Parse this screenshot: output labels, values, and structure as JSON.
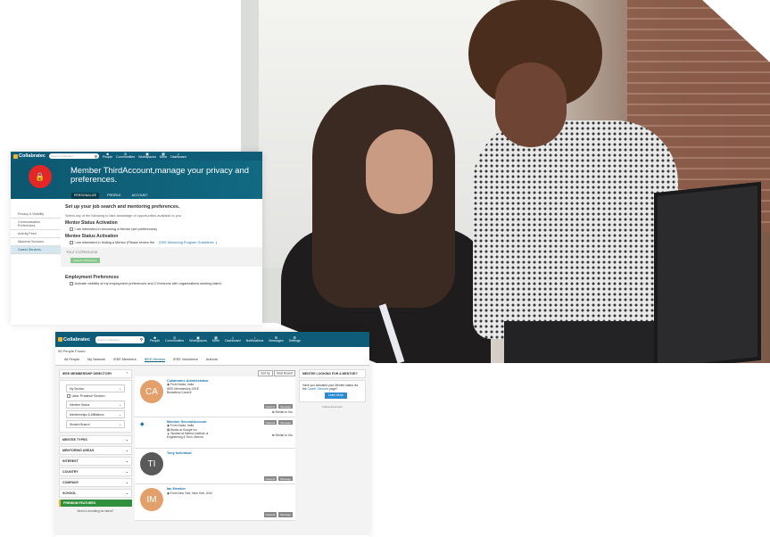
{
  "brand": {
    "name": "Collabratec",
    "mark": "IEEE"
  },
  "colors": {
    "nav": "#0f5c79",
    "accent": "#f2b334",
    "premium": "#2f8f3c",
    "button": "#2d8bd0"
  },
  "nav": {
    "search_placeholder": "Search Collabratec",
    "items": [
      "People",
      "Communities",
      "Workspaces",
      "More",
      "Dashboard",
      "Notifications",
      "Messages",
      "Settings"
    ]
  },
  "privacy": {
    "title": "Member ThirdAccount,manage your privacy and preferences.",
    "tabs": [
      "PERSONALIZE",
      "PROFILE",
      "ACCOUNT"
    ],
    "sidebar": [
      "Privacy & Visibility",
      "Communication Preferences",
      "Activity Feed",
      "Attached Services",
      "Career Services"
    ],
    "heading": "Set up your job search and mentoring preferences.",
    "intro": "Select any of the following to take advantage of opportunities available to you.",
    "mentor_status_title": "Mentor Status Activation",
    "mentor_status_option": "I am interested in becoming a Mentor (set preferences)",
    "mentee_status_title": "Mentee Status Activation",
    "mentee_status_option": "I am interested in finding a Mentor (Please review the",
    "mentee_link": "IEEE Mentoring Program Guidelines",
    "mentee_tail": ")",
    "cv_title": "Your CV/Resume",
    "cv_button": "Upload CV/Resume",
    "employment_title": "Employment Preferences",
    "employment_option": "Activate visibility of my employment preferences and CV/resume with organizations seeking talent."
  },
  "people": {
    "found": "95 People Found",
    "tabs": [
      "All People",
      "My Network",
      "IEEE Members",
      "IEEE Mentors",
      "IEEE Volunteers",
      "Authors"
    ],
    "directory_title": "IEEE MEMBERSHIP DIRECTORY",
    "my_section": "My Section",
    "uttar_section": "Uttar Pradesh Section",
    "member_status": "Member Status",
    "memberships": "Memberships & Affiliations",
    "student_branch": "Student Branch",
    "filters": [
      "MENTEE TYPES",
      "MENTORING AREAS",
      "INTEREST",
      "COUNTRY",
      "COMPANY",
      "SCHOOL"
    ],
    "premium": "PREMIUM FEATURES",
    "recruiting": "Need a recruiting for talent?",
    "sort_label": "Sort by:",
    "sort_value": "Most Recent",
    "network_label": "Network",
    "message_label": "Message",
    "similar_label": "Similar to You",
    "cards": [
      {
        "initials": "CA",
        "color": "#e3a06b",
        "name": "Collabratec Administrator",
        "l1": "From Noida, India",
        "l2": "IEEE Membership: IEEE",
        "l3": "Biometrics Council",
        "l4": ""
      },
      {
        "initials": "",
        "color": "#ffffff",
        "name": "Member SecondAccount",
        "l1": "From Noida, India",
        "l2": "Works at Google Inc",
        "l3": "Studied at Meerut Institute of",
        "l4": "Engineering & Tech, Meerut"
      },
      {
        "initials": "TI",
        "color": "#595959",
        "name": "Tony Individual",
        "l1": "",
        "l2": "",
        "l3": "",
        "l4": ""
      },
      {
        "initials": "IM",
        "color": "#e3a06b",
        "name": "Ian Member",
        "l1": "From New York, New York, USA",
        "l2": "",
        "l3": "",
        "l4": ""
      }
    ],
    "mentee_title": "MENTEE LOOKING FOR A MENTOR?",
    "mentee_text": "Have you activated your Mentee status via the",
    "mentee_link": "Career Services",
    "mentee_text2": "page?",
    "learn_more": "Learn More",
    "mentee_foot": "Follow Extension"
  }
}
